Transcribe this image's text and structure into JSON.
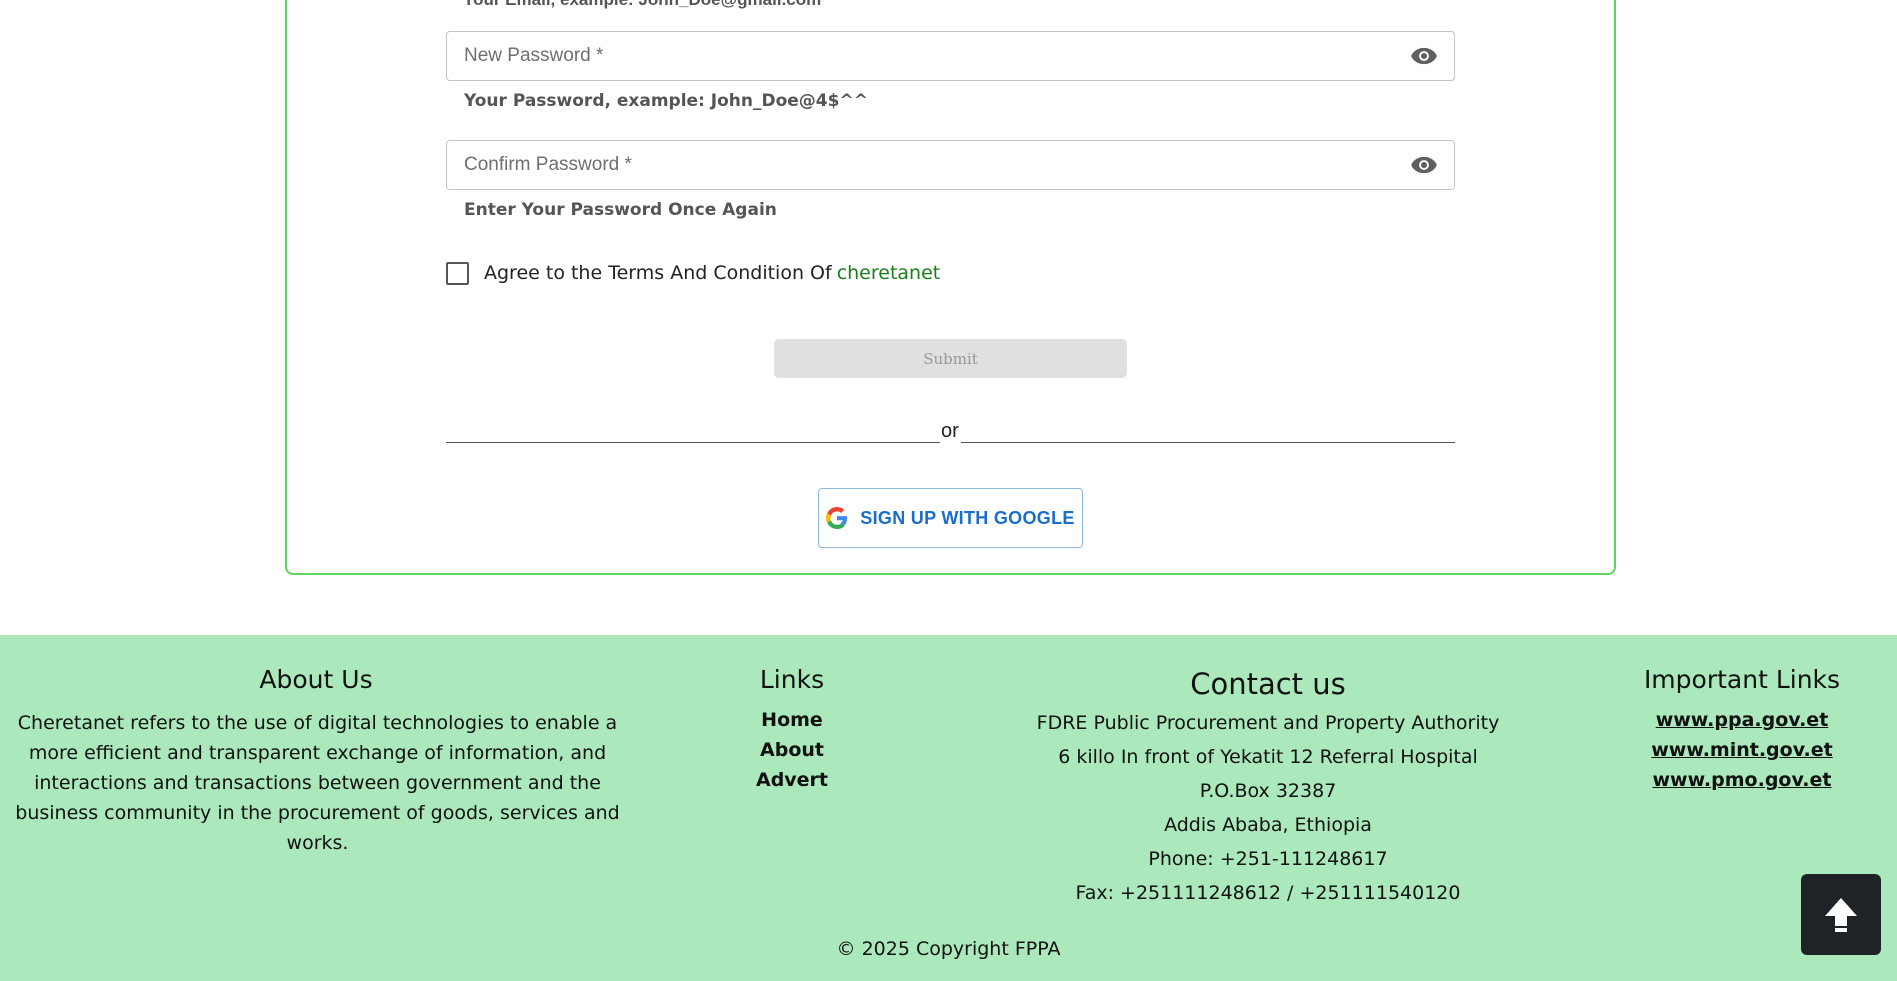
{
  "form": {
    "cut_off_text": "Your Email, example: John_Doe@gmail.com",
    "new_password": {
      "placeholder": "New Password *",
      "value": "",
      "helper": "Your Password, example: John_Doe@4$^^"
    },
    "confirm_password": {
      "placeholder": "Confirm Password *",
      "value": "",
      "helper": "Enter Your Password Once Again"
    },
    "agree": {
      "checked": false,
      "text": "Agree to the Terms And Condition Of",
      "link": "cheretanet"
    },
    "submit_label": "Submit",
    "divider_text": "or",
    "google_label": "SIGN UP WITH GOOGLE"
  },
  "footer": {
    "about": {
      "title": "About Us",
      "text": "Cheretanet refers to the use of digital technologies to enable a more efficient and transparent exchange of information, and interactions and transactions between government and the business community in the procurement of goods, services and works."
    },
    "links": {
      "title": "Links",
      "items": [
        "Home",
        "About",
        "Advert"
      ]
    },
    "contact": {
      "title": "Contact us",
      "lines": [
        "FDRE Public Procurement and Property Authority",
        "6 killo In front of Yekatit 12 Referral Hospital",
        "P.O.Box 32387",
        "Addis Ababa, Ethiopia",
        "Phone: +251-111248617",
        "Fax: +251111248612 / +251111540120"
      ]
    },
    "important_links": {
      "title": "Important Links",
      "items": [
        "www.ppa.gov.et",
        "www.mint.gov.et",
        "www.pmo.gov.et"
      ]
    },
    "copyright": "© 2025 Copyright FPPA"
  },
  "colors": {
    "card_border": "#5cd65c",
    "footer_bg": "#abe9bc",
    "link_green": "#1a7f1a",
    "google_blue": "#1a6ec8"
  }
}
